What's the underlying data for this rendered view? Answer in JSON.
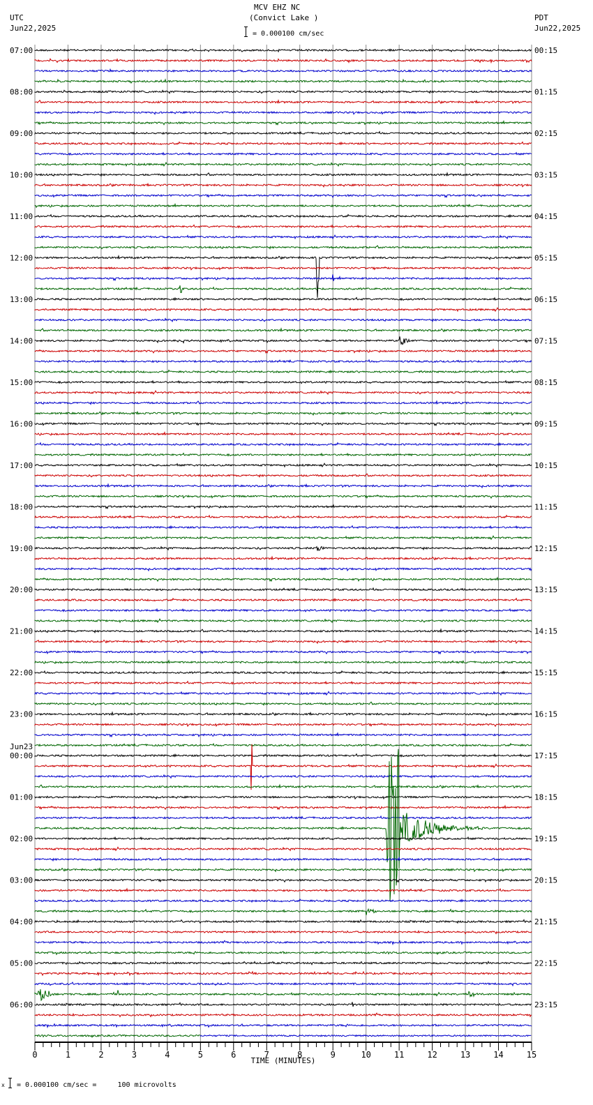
{
  "header": {
    "station": "MCV EHZ NC",
    "location": "(Convict Lake )",
    "scale": "= 0.000100 cm/sec",
    "left_tz": "UTC",
    "left_date": "Jun22,2025",
    "right_tz": "PDT",
    "right_date": "Jun22,2025"
  },
  "footer": {
    "scale_note": "= 0.000100 cm/sec =     100 microvolts",
    "mark": "x"
  },
  "chart_data": {
    "type": "line",
    "title": "MCV EHZ NC (Convict Lake )",
    "xlabel": "TIME (MINUTES)",
    "xlim": [
      0,
      15
    ],
    "xticks": [
      "0",
      "1",
      "2",
      "3",
      "4",
      "5",
      "6",
      "7",
      "8",
      "9",
      "10",
      "11",
      "12",
      "13",
      "14",
      "15"
    ],
    "traces_per_hour": 4,
    "trace_colors": [
      "#000000",
      "#cc0000",
      "#0000cc",
      "#006600"
    ],
    "left_labels": [
      "07:00",
      "08:00",
      "09:00",
      "10:00",
      "11:00",
      "12:00",
      "13:00",
      "14:00",
      "15:00",
      "16:00",
      "17:00",
      "18:00",
      "19:00",
      "20:00",
      "21:00",
      "22:00",
      "23:00",
      "00:00",
      "01:00",
      "02:00",
      "03:00",
      "04:00",
      "05:00",
      "06:00"
    ],
    "date_change_label": "Jun23",
    "date_change_index": 17,
    "right_labels": [
      "00:15",
      "01:15",
      "02:15",
      "03:15",
      "04:15",
      "05:15",
      "06:15",
      "07:15",
      "08:15",
      "09:15",
      "10:15",
      "11:15",
      "12:15",
      "13:15",
      "14:15",
      "15:15",
      "16:15",
      "17:15",
      "18:15",
      "19:15",
      "20:15",
      "21:15",
      "22:15",
      "23:15"
    ],
    "events": [
      {
        "trace": 20,
        "minute": 8.55,
        "amplitude": 4.0,
        "duration": 0.08,
        "kind": "spike"
      },
      {
        "trace": 22,
        "minute": 9.0,
        "amplitude": 0.6,
        "duration": 0.05,
        "kind": "spike"
      },
      {
        "trace": 23,
        "minute": 4.4,
        "amplitude": 0.4,
        "duration": 0.05,
        "kind": "spike"
      },
      {
        "trace": 28,
        "minute": 4.4,
        "amplitude": 0.2,
        "duration": 0.4,
        "kind": "burst"
      },
      {
        "trace": 28,
        "minute": 11.0,
        "amplitude": 0.6,
        "duration": 0.4,
        "kind": "burst"
      },
      {
        "trace": 48,
        "minute": 8.5,
        "amplitude": 0.4,
        "duration": 0.3,
        "kind": "burst"
      },
      {
        "trace": 69,
        "minute": 6.55,
        "amplitude": 2.5,
        "duration": 0.04,
        "kind": "spike"
      },
      {
        "trace": 75,
        "minute": 10.6,
        "amplitude": 8.0,
        "duration": 3.0,
        "kind": "quake"
      },
      {
        "trace": 83,
        "minute": 10.0,
        "amplitude": 0.4,
        "duration": 0.4,
        "kind": "burst"
      },
      {
        "trace": 91,
        "minute": 0.1,
        "amplitude": 0.8,
        "duration": 0.5,
        "kind": "burst"
      },
      {
        "trace": 91,
        "minute": 2.5,
        "amplitude": 0.4,
        "duration": 0.1,
        "kind": "burst"
      },
      {
        "trace": 91,
        "minute": 13.1,
        "amplitude": 0.4,
        "duration": 0.3,
        "kind": "burst"
      },
      {
        "trace": 92,
        "minute": 9.6,
        "amplitude": 0.4,
        "duration": 0.05,
        "kind": "spike"
      }
    ]
  }
}
